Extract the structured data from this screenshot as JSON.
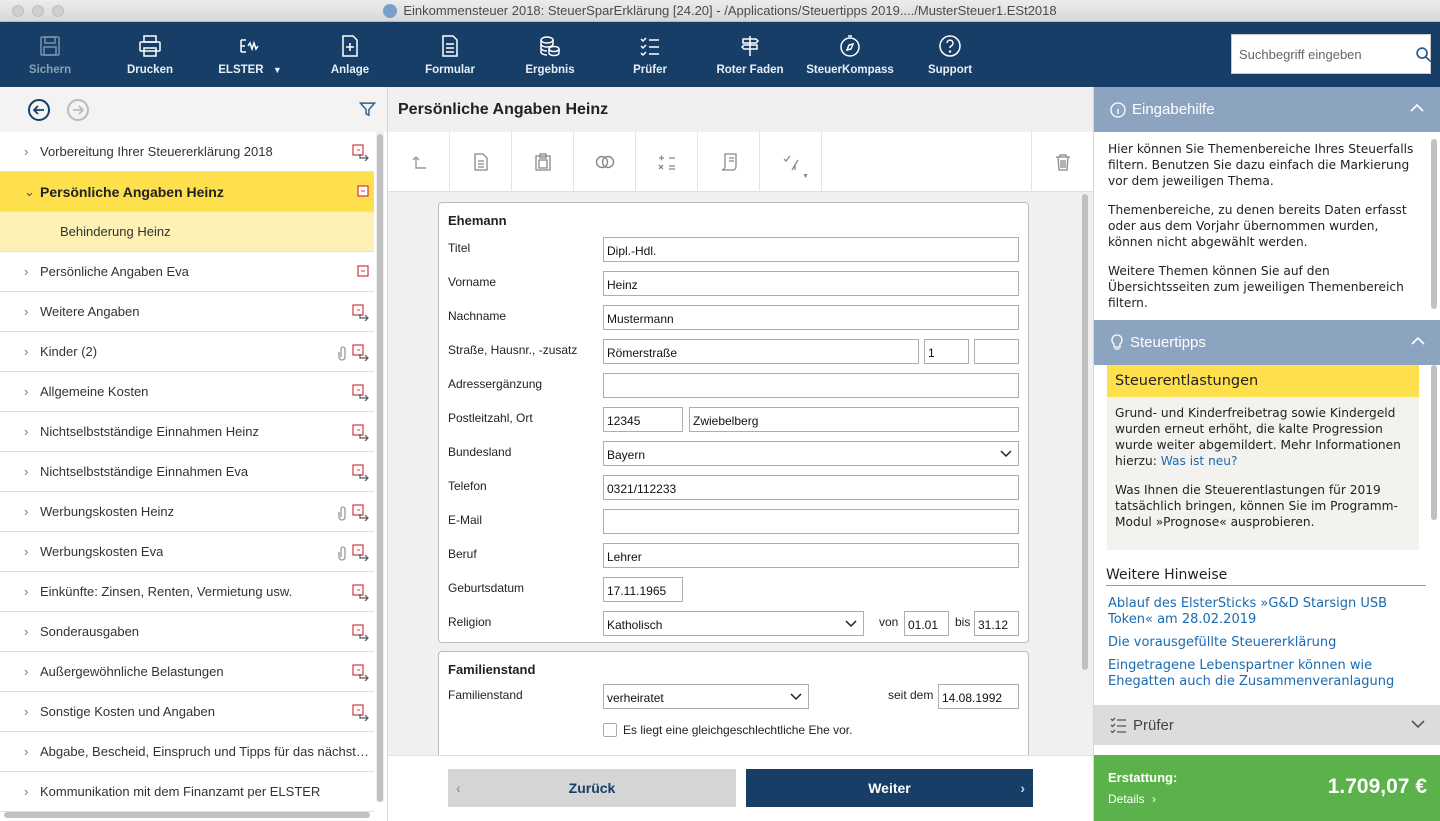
{
  "window": {
    "title": "Einkommensteuer 2018: SteuerSparErklärung [24.20] - /Applications/Steuertipps 2019..../MusterSteuer1.ESt2018"
  },
  "toolbar": {
    "items": [
      {
        "label": "Sichern",
        "icon": "save-icon"
      },
      {
        "label": "Drucken",
        "icon": "print-icon"
      },
      {
        "label": "ELSTER",
        "icon": "elster-icon"
      },
      {
        "label": "Anlage",
        "icon": "add-document-icon"
      },
      {
        "label": "Formular",
        "icon": "form-icon"
      },
      {
        "label": "Ergebnis",
        "icon": "coins-icon"
      },
      {
        "label": "Prüfer",
        "icon": "checklist-icon"
      },
      {
        "label": "Roter Faden",
        "icon": "signpost-icon"
      },
      {
        "label": "SteuerKompass",
        "icon": "compass-icon"
      },
      {
        "label": "Support",
        "icon": "question-icon"
      }
    ],
    "search_placeholder": "Suchbegriff eingeben"
  },
  "nav": {
    "items": [
      {
        "label": "Vorbereitung Ihrer Steuererklärung 2018"
      },
      {
        "label": "Persönliche Angaben Heinz"
      },
      {
        "label": "Behinderung Heinz"
      },
      {
        "label": "Persönliche Angaben Eva"
      },
      {
        "label": "Weitere Angaben"
      },
      {
        "label": "Kinder (2)"
      },
      {
        "label": "Allgemeine Kosten"
      },
      {
        "label": "Nichtselbstständige Einnahmen Heinz"
      },
      {
        "label": "Nichtselbstständige Einnahmen Eva"
      },
      {
        "label": "Werbungskosten Heinz"
      },
      {
        "label": "Werbungskosten Eva"
      },
      {
        "label": "Einkünfte: Zinsen, Renten, Vermietung usw."
      },
      {
        "label": "Sonderausgaben"
      },
      {
        "label": "Außergewöhnliche Belastungen"
      },
      {
        "label": "Sonstige Kosten und Angaben"
      },
      {
        "label": "Abgabe, Bescheid, Einspruch und Tipps für das nächste Jahr"
      },
      {
        "label": "Kommunikation mit dem Finanzamt per ELSTER"
      }
    ]
  },
  "page": {
    "title": "Persönliche Angaben Heinz"
  },
  "ehemann": {
    "heading": "Ehemann",
    "titel_label": "Titel",
    "titel": "Dipl.-Hdl.",
    "vorname_label": "Vorname",
    "vorname": "Heinz",
    "nachname_label": "Nachname",
    "nachname": "Mustermann",
    "strasse_label": "Straße, Hausnr., -zusatz",
    "strasse": "Römerstraße",
    "hausnr": "1",
    "zusatz": "",
    "adresse_label": "Adressergänzung",
    "adresse": "",
    "plz_label": "Postleitzahl, Ort",
    "plz": "12345",
    "ort": "Zwiebelberg",
    "bundesland_label": "Bundesland",
    "bundesland": "Bayern",
    "telefon_label": "Telefon",
    "telefon": "0321/112233",
    "email_label": "E-Mail",
    "email": "",
    "beruf_label": "Beruf",
    "beruf": "Lehrer",
    "geburtsdatum_label": "Geburtsdatum",
    "geburtsdatum": "17.11.1965",
    "religion_label": "Religion",
    "religion": "Katholisch",
    "von_label": "von",
    "von": "01.01",
    "bis_label": "bis",
    "bis": "31.12"
  },
  "familienstand": {
    "heading": "Familienstand",
    "label": "Familienstand",
    "value": "verheiratet",
    "seit_label": "seit dem",
    "seit": "14.08.1992",
    "checkbox_label": "Es liegt eine gleichgeschlechtliche Ehe vor."
  },
  "buttons": {
    "back": "Zurück",
    "next": "Weiter"
  },
  "help": {
    "title": "Eingabehilfe",
    "paragraphs": [
      "Hier können Sie Themenbereiche Ihres Steuerfalls filtern. Benutzen Sie dazu einfach die Markierung vor dem jeweiligen Thema.",
      "Themenbereiche, zu denen bereits Daten erfasst oder aus dem Vorjahr übernommen wurden, können nicht abgewählt werden.",
      "Weitere Themen können Sie auf den Übersichtsseiten zum jeweiligen Themenbereich filtern."
    ]
  },
  "tips": {
    "title": "Steuertipps",
    "box_title": "Steuerentlastungen",
    "p1": "Grund- und Kinderfreibetrag sowie Kindergeld wurden erneut erhöht, die kalte Progression wurde weiter abgemildert. Mehr Informationen hierzu: ",
    "p1_link": "Was ist neu?",
    "p2": "Was Ihnen die Steuerentlastungen für 2019 tatsächlich bringen, können Sie im Programm-Modul »Prognose« ausprobieren.",
    "more_heading": "Weitere Hinweise",
    "links": [
      "Ablauf des ElsterSticks »G&D Starsign USB Token« am 28.02.2019",
      "Die vorausgefüllte Steuererklärung",
      "Eingetragene Lebenspartner können wie Ehegatten auch die Zusammenveranlagung"
    ]
  },
  "pruefer": {
    "title": "Prüfer"
  },
  "refund": {
    "label": "Erstattung:",
    "details": "Details",
    "amount": "1.709,07 €"
  },
  "colors": {
    "toolbar": "#163e67",
    "accent_yellow": "#fde04c",
    "panel_header": "#8da4c1",
    "refund_green": "#5bb24a",
    "link": "#1b6ab0"
  }
}
